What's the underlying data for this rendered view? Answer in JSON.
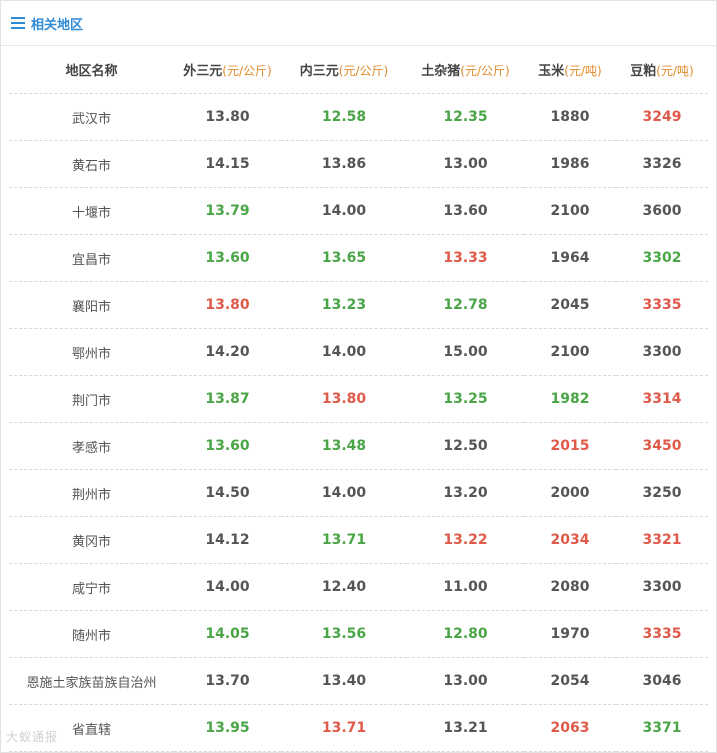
{
  "header": {
    "title": "相关地区",
    "icon": "menu-icon"
  },
  "table": {
    "columns": [
      {
        "label": "地区名称",
        "unit": ""
      },
      {
        "label": "外三元",
        "unit": "(元/公斤)"
      },
      {
        "label": "内三元",
        "unit": "(元/公斤)"
      },
      {
        "label": "土杂猪",
        "unit": "(元/公斤)"
      },
      {
        "label": "玉米",
        "unit": "(元/吨)"
      },
      {
        "label": "豆粕",
        "unit": "(元/吨)"
      }
    ],
    "rows": [
      {
        "region": "武汉市",
        "values": [
          "13.80",
          "12.58",
          "12.35",
          "1880",
          "3249"
        ],
        "colors": [
          "gray",
          "green",
          "green",
          "gray",
          "red"
        ]
      },
      {
        "region": "黄石市",
        "values": [
          "14.15",
          "13.86",
          "13.00",
          "1986",
          "3326"
        ],
        "colors": [
          "gray",
          "gray",
          "gray",
          "gray",
          "gray"
        ]
      },
      {
        "region": "十堰市",
        "values": [
          "13.79",
          "14.00",
          "13.60",
          "2100",
          "3600"
        ],
        "colors": [
          "green",
          "gray",
          "gray",
          "gray",
          "gray"
        ]
      },
      {
        "region": "宜昌市",
        "values": [
          "13.60",
          "13.65",
          "13.33",
          "1964",
          "3302"
        ],
        "colors": [
          "green",
          "green",
          "red",
          "gray",
          "green"
        ]
      },
      {
        "region": "襄阳市",
        "values": [
          "13.80",
          "13.23",
          "12.78",
          "2045",
          "3335"
        ],
        "colors": [
          "red",
          "green",
          "green",
          "gray",
          "red"
        ]
      },
      {
        "region": "鄂州市",
        "values": [
          "14.20",
          "14.00",
          "15.00",
          "2100",
          "3300"
        ],
        "colors": [
          "gray",
          "gray",
          "gray",
          "gray",
          "gray"
        ]
      },
      {
        "region": "荆门市",
        "values": [
          "13.87",
          "13.80",
          "13.25",
          "1982",
          "3314"
        ],
        "colors": [
          "green",
          "red",
          "green",
          "green",
          "red"
        ]
      },
      {
        "region": "孝感市",
        "values": [
          "13.60",
          "13.48",
          "12.50",
          "2015",
          "3450"
        ],
        "colors": [
          "green",
          "green",
          "gray",
          "red",
          "red"
        ]
      },
      {
        "region": "荆州市",
        "values": [
          "14.50",
          "14.00",
          "13.20",
          "2000",
          "3250"
        ],
        "colors": [
          "gray",
          "gray",
          "gray",
          "gray",
          "gray"
        ]
      },
      {
        "region": "黄冈市",
        "values": [
          "14.12",
          "13.71",
          "13.22",
          "2034",
          "3321"
        ],
        "colors": [
          "gray",
          "green",
          "red",
          "red",
          "red"
        ]
      },
      {
        "region": "咸宁市",
        "values": [
          "14.00",
          "12.40",
          "11.00",
          "2080",
          "3300"
        ],
        "colors": [
          "gray",
          "gray",
          "gray",
          "gray",
          "gray"
        ]
      },
      {
        "region": "随州市",
        "values": [
          "14.05",
          "13.56",
          "12.80",
          "1970",
          "3335"
        ],
        "colors": [
          "green",
          "green",
          "green",
          "gray",
          "red"
        ]
      },
      {
        "region": "恩施土家族苗族自治州",
        "values": [
          "13.70",
          "13.40",
          "13.00",
          "2054",
          "3046"
        ],
        "colors": [
          "gray",
          "gray",
          "gray",
          "gray",
          "gray"
        ]
      },
      {
        "region": "省直辖",
        "values": [
          "13.95",
          "13.71",
          "13.21",
          "2063",
          "3371"
        ],
        "colors": [
          "green",
          "red",
          "gray",
          "red",
          "green"
        ]
      }
    ]
  },
  "watermark": "大蚁通报"
}
